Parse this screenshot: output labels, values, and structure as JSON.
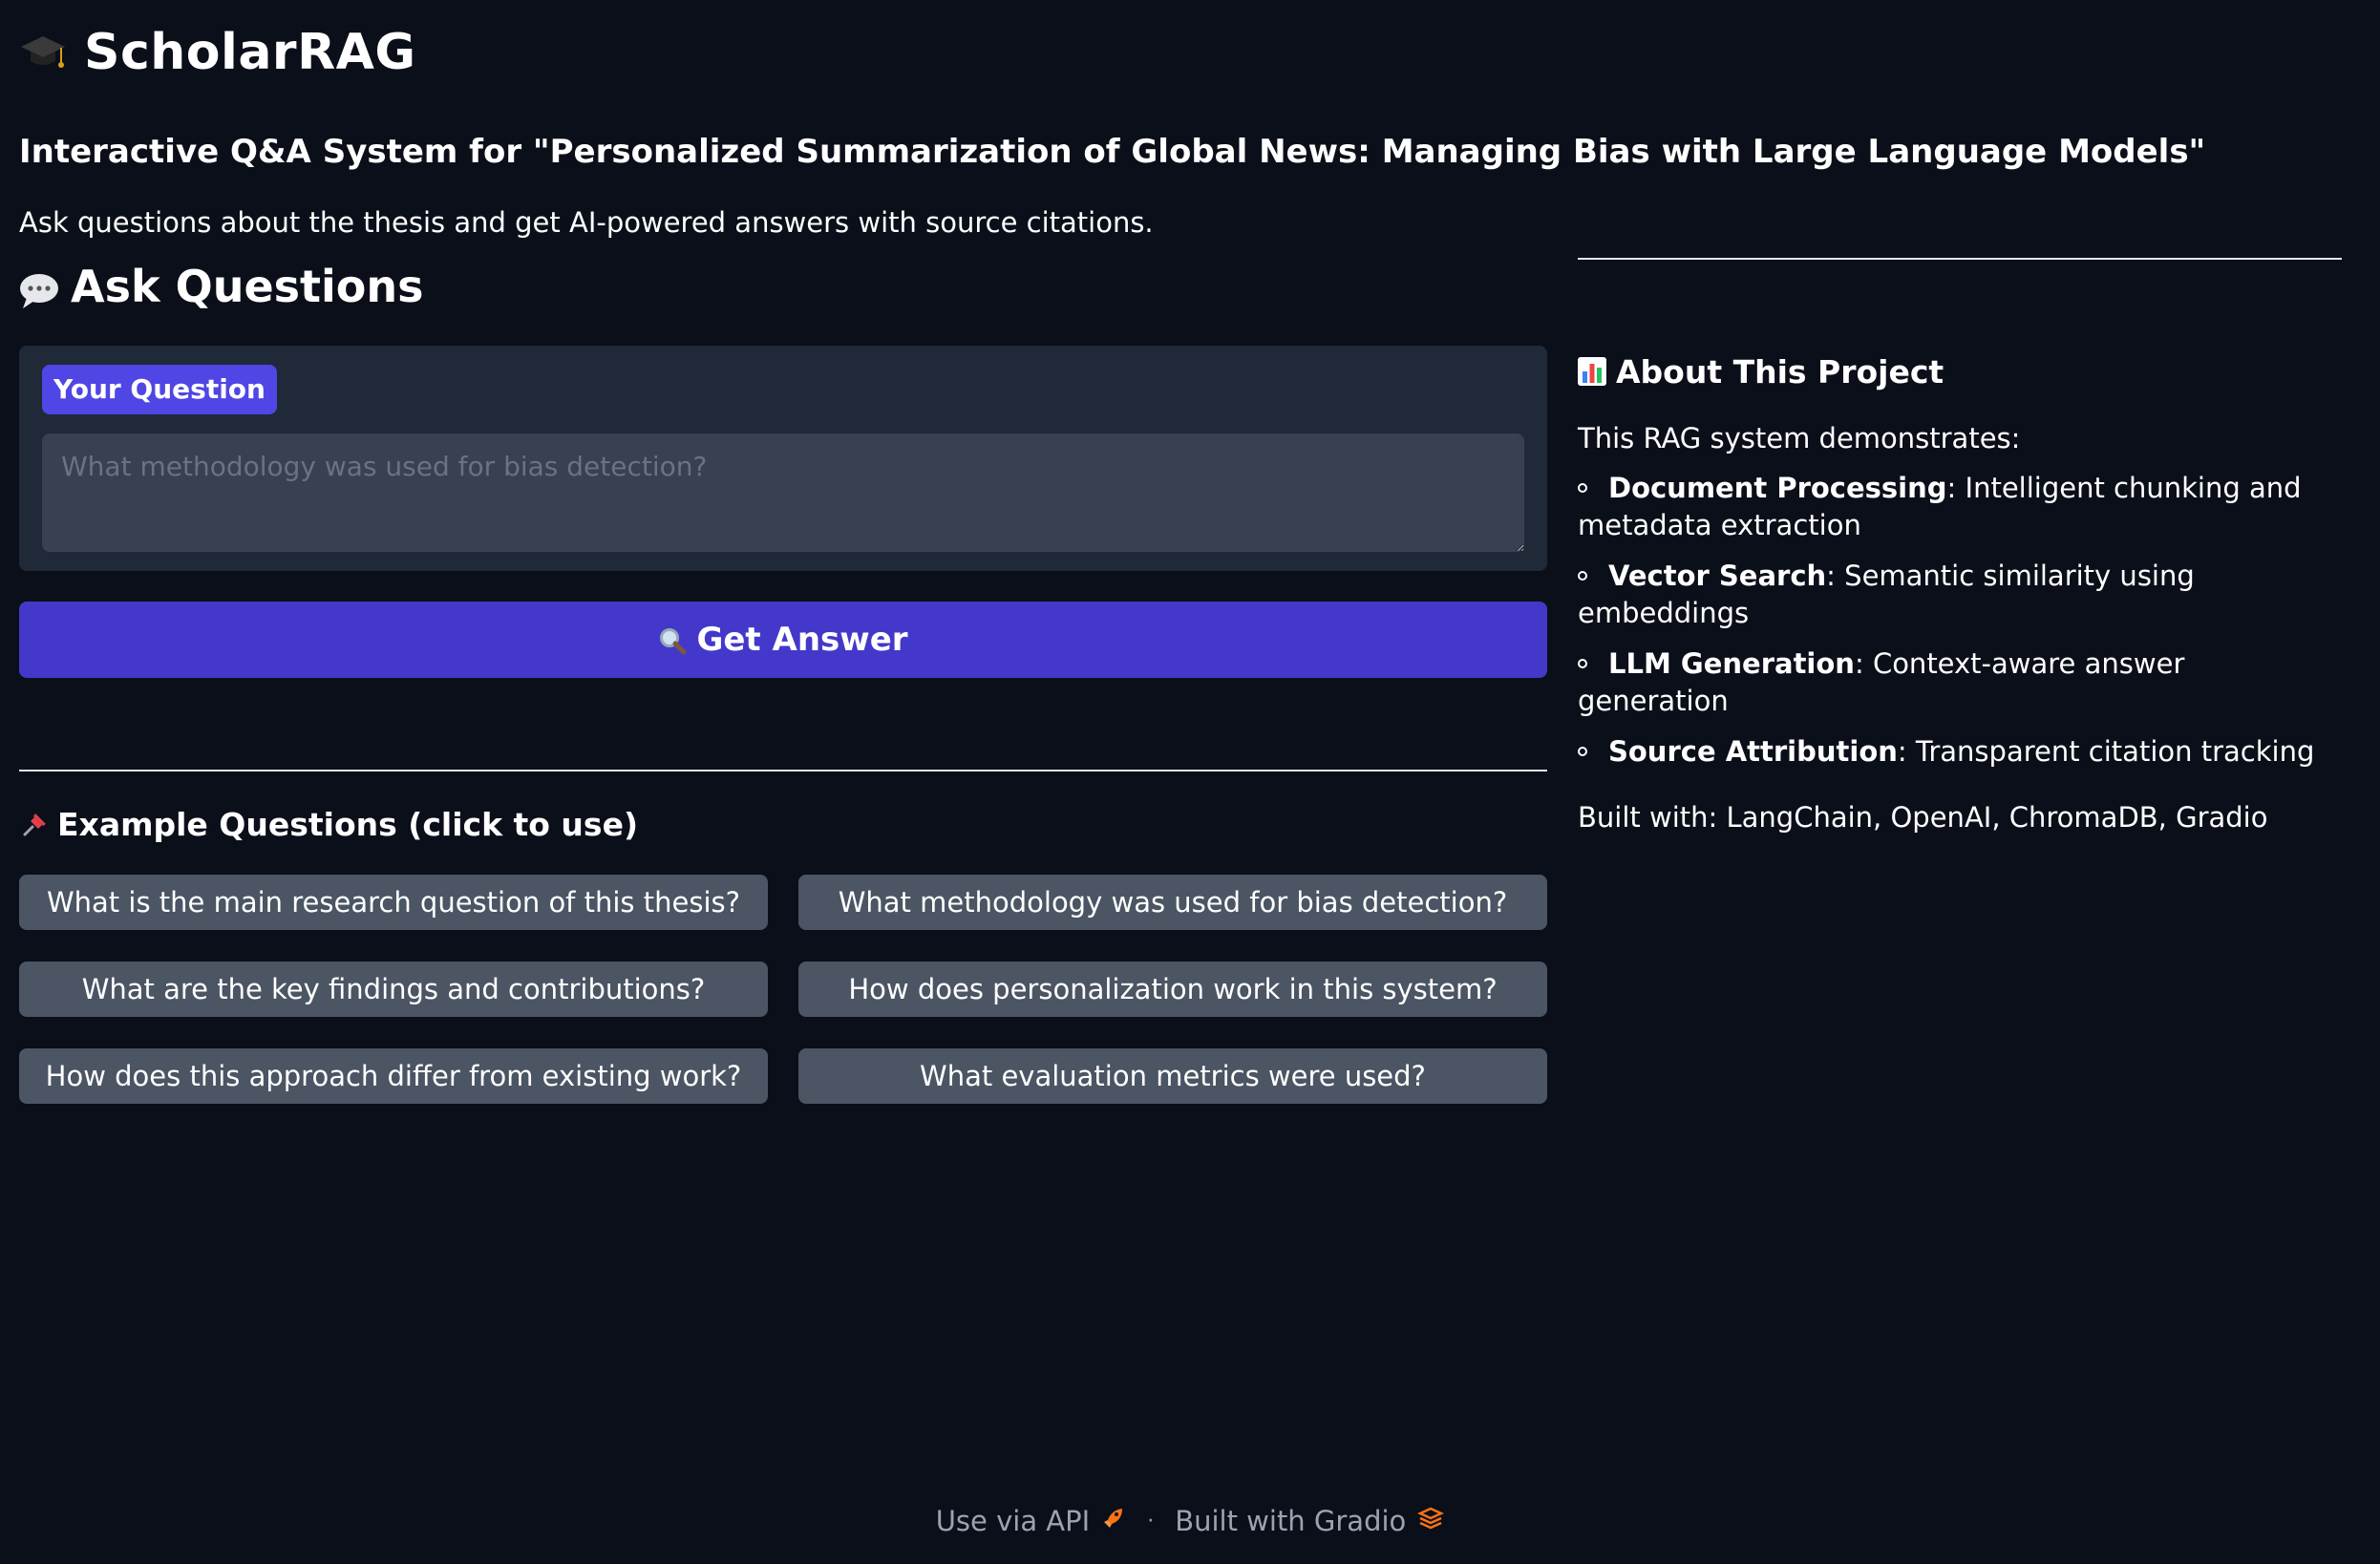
{
  "app": {
    "title": "ScholarRAG",
    "subtitle": "Interactive Q&A System for \"Personalized Summarization of Global News: Managing Bias with Large Language Models\"",
    "description": "Ask questions about the thesis and get AI-powered answers with source citations."
  },
  "ask": {
    "section_title": "Ask Questions",
    "question_label": "Your Question",
    "question_placeholder": "What methodology was used for bias detection?",
    "question_value": "",
    "submit_label": "Get Answer"
  },
  "examples": {
    "title": "Example Questions (click to use)",
    "items": [
      "What is the main research question of this thesis?",
      "What methodology was used for bias detection?",
      "What are the key findings and contributions?",
      "How does personalization work in this system?",
      "How does this approach differ from existing work?",
      "What evaluation metrics were used?"
    ]
  },
  "about": {
    "title": "About This Project",
    "intro": "This RAG system demonstrates:",
    "features": [
      {
        "name": "Document Processing",
        "desc": ": Intelligent chunking and metadata extraction"
      },
      {
        "name": "Vector Search",
        "desc": ": Semantic similarity using embeddings"
      },
      {
        "name": "LLM Generation",
        "desc": ": Context-aware answer generation"
      },
      {
        "name": "Source Attribution",
        "desc": ": Transparent citation tracking"
      }
    ],
    "built_with": "Built with: LangChain, OpenAI, ChromaDB, Gradio"
  },
  "footer": {
    "api_label": "Use via API",
    "separator": "·",
    "built_label": "Built with Gradio"
  },
  "icons": {
    "title_icon": "graduation-cap-icon",
    "ask_icon": "speech-bubble-icon",
    "submit_icon": "magnifier-icon",
    "examples_icon": "pushpin-icon",
    "about_icon": "bar-chart-icon",
    "api_icon": "rocket-icon",
    "gradio_icon": "gradio-logo-icon"
  },
  "colors": {
    "background": "#0b0f19",
    "panel": "#1f2937",
    "input": "#374151",
    "accent": "#4f46e5",
    "button_primary": "#4338ca",
    "button_secondary": "#4b5563"
  }
}
